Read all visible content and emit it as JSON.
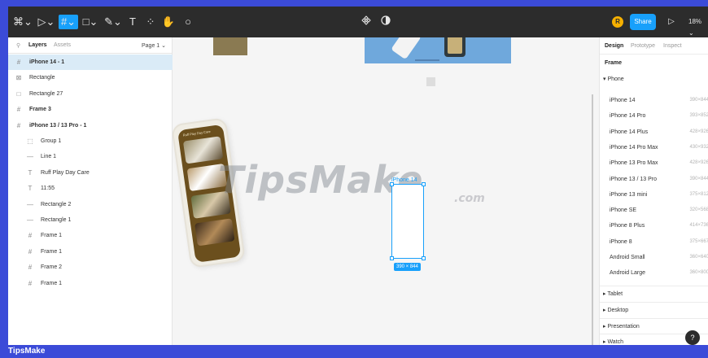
{
  "toolbar": {
    "tools": [
      {
        "name": "main-menu",
        "glyph": "⌘⌄"
      },
      {
        "name": "move-tool",
        "glyph": "▷⌄"
      },
      {
        "name": "frame-tool",
        "glyph": "#⌄"
      },
      {
        "name": "shape-tool",
        "glyph": "□⌄"
      },
      {
        "name": "pen-tool",
        "glyph": "✎⌄"
      },
      {
        "name": "text-tool",
        "glyph": "T"
      },
      {
        "name": "resources-tool",
        "glyph": "⁘"
      },
      {
        "name": "hand-tool",
        "glyph": "✋"
      },
      {
        "name": "comment-tool",
        "glyph": "○"
      }
    ],
    "center_icons": [
      "component-icon",
      "contrast-icon"
    ],
    "avatar_initial": "R",
    "share_label": "Share",
    "present_icon": "play-icon",
    "zoom": "18% ⌄"
  },
  "left_panel": {
    "tabs": [
      "Layers",
      "Assets"
    ],
    "page": "Page 1 ⌄",
    "layers": [
      {
        "icon": "#",
        "label": "iPhone 14 - 1",
        "bold": true,
        "indent": 0,
        "selected": true
      },
      {
        "icon": "⊠",
        "label": "Rectangle",
        "bold": false,
        "indent": 0,
        "selected": false
      },
      {
        "icon": "□",
        "label": "Rectangle 27",
        "bold": false,
        "indent": 0,
        "selected": false
      },
      {
        "icon": "#",
        "label": "Frame 3",
        "bold": true,
        "indent": 0,
        "selected": false
      },
      {
        "icon": "#",
        "label": "iPhone 13 / 13 Pro - 1",
        "bold": true,
        "indent": 0,
        "selected": false
      },
      {
        "icon": "⬚",
        "label": "Group 1",
        "bold": false,
        "indent": 1,
        "selected": false
      },
      {
        "icon": "—",
        "label": "Line 1",
        "bold": false,
        "indent": 1,
        "selected": false
      },
      {
        "icon": "T",
        "label": "Ruff Play Day Care",
        "bold": false,
        "indent": 1,
        "selected": false
      },
      {
        "icon": "T",
        "label": "11:55",
        "bold": false,
        "indent": 1,
        "selected": false
      },
      {
        "icon": "—",
        "label": "Rectangle 2",
        "bold": false,
        "indent": 1,
        "selected": false
      },
      {
        "icon": "—",
        "label": "Rectangle 1",
        "bold": false,
        "indent": 1,
        "selected": false
      },
      {
        "icon": "#",
        "label": "Frame 1",
        "bold": false,
        "indent": 1,
        "selected": false
      },
      {
        "icon": "#",
        "label": "Frame 1",
        "bold": false,
        "indent": 1,
        "selected": false
      },
      {
        "icon": "#",
        "label": "Frame 2",
        "bold": false,
        "indent": 1,
        "selected": false
      },
      {
        "icon": "#",
        "label": "Frame 1",
        "bold": false,
        "indent": 1,
        "selected": false
      }
    ]
  },
  "canvas": {
    "watermark": "TipsMake",
    "watermark_suffix": ".com",
    "mock_title": "Ruff Play Day Care",
    "selected_frame_label": "iPhone 14",
    "selected_frame_dims": "390 × 844"
  },
  "right_panel": {
    "tabs": [
      "Design",
      "Prototype",
      "Inspect"
    ],
    "frame_label": "Frame",
    "category_open": "▾ Phone",
    "presets": [
      {
        "name": "iPhone 14",
        "dims": "390×844"
      },
      {
        "name": "iPhone 14 Pro",
        "dims": "393×852"
      },
      {
        "name": "iPhone 14 Plus",
        "dims": "428×926"
      },
      {
        "name": "iPhone 14 Pro Max",
        "dims": "430×932"
      },
      {
        "name": "iPhone 13 Pro Max",
        "dims": "428×926"
      },
      {
        "name": "iPhone 13 / 13 Pro",
        "dims": "390×844"
      },
      {
        "name": "iPhone 13 mini",
        "dims": "375×812"
      },
      {
        "name": "iPhone SE",
        "dims": "320×568"
      },
      {
        "name": "iPhone 8 Plus",
        "dims": "414×736"
      },
      {
        "name": "iPhone 8",
        "dims": "375×667"
      },
      {
        "name": "Android Small",
        "dims": "360×640"
      },
      {
        "name": "Android Large",
        "dims": "360×800"
      }
    ],
    "sections": [
      "▸ Tablet",
      "▸ Desktop",
      "▸ Presentation",
      "▸ Watch"
    ],
    "help": "?"
  },
  "footer": {
    "brand": "TipsMake"
  },
  "colors": {
    "accent": "#18a0fb",
    "toolbar_bg": "#2c2c2c",
    "border_blue": "#3b4bd8"
  }
}
